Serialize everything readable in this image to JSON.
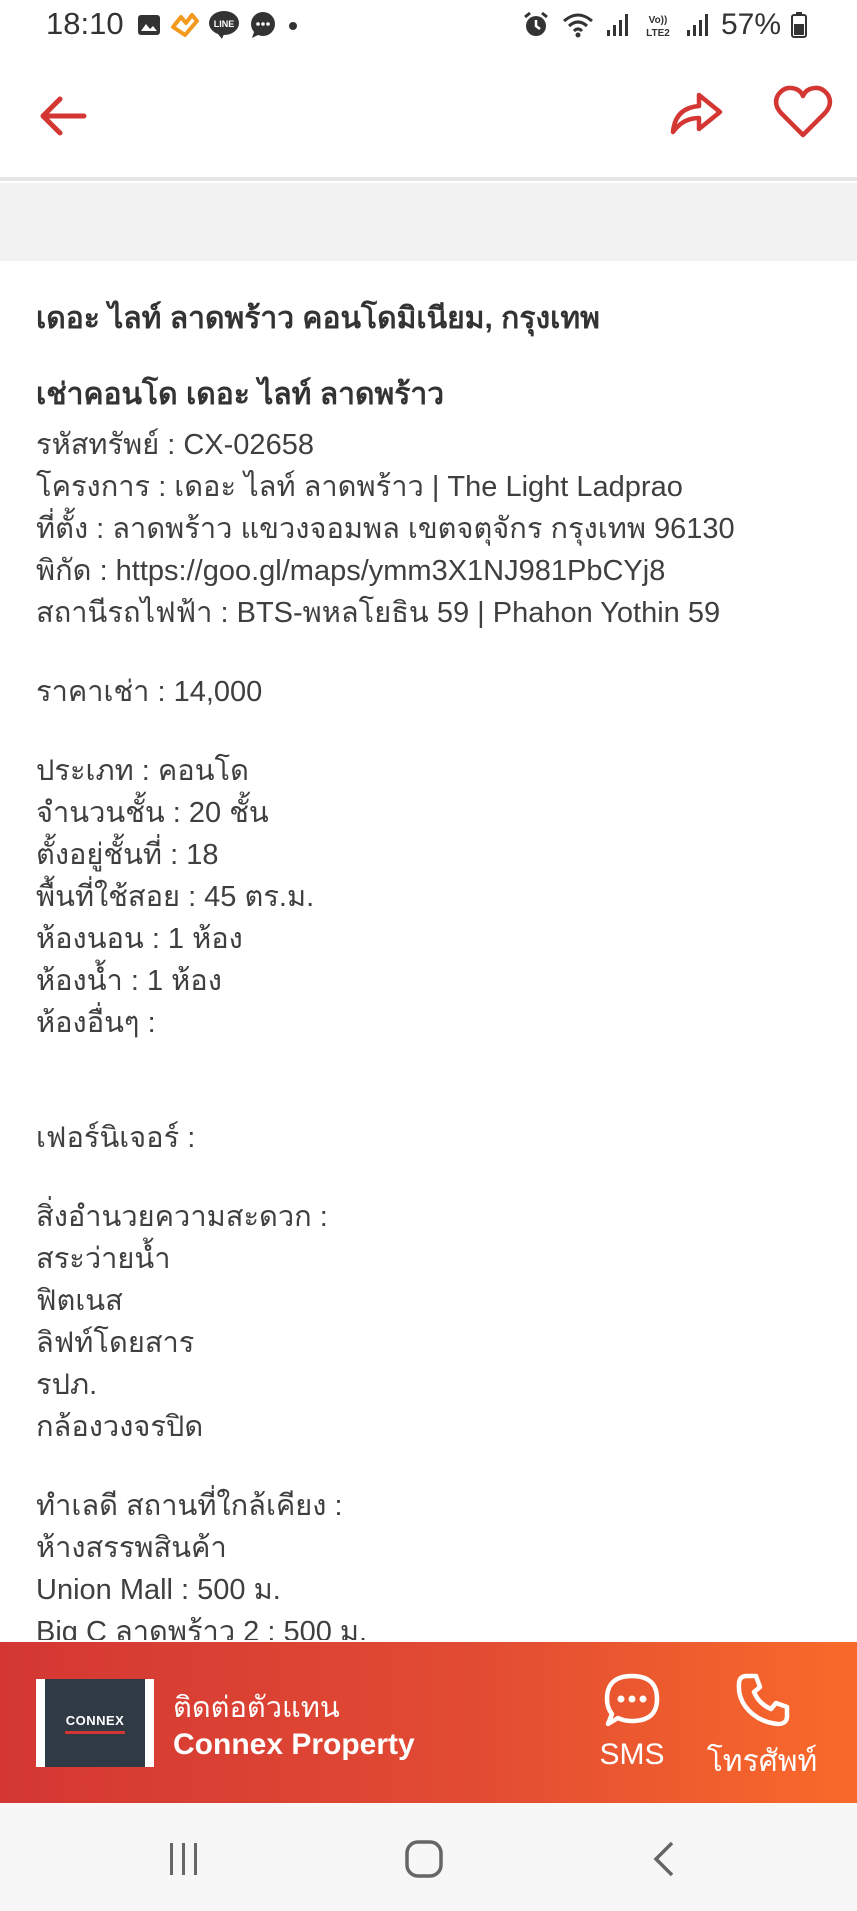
{
  "status_bar": {
    "time": "18:10",
    "battery": "57%",
    "left_icons": [
      "gallery-icon",
      "app-notification-icon",
      "line-icon",
      "chat-icon",
      "dot-icon"
    ],
    "right_icons": [
      "alarm-icon",
      "wifi-icon",
      "signal-icon",
      "volte-icon",
      "signal-icon",
      "battery-icon"
    ]
  },
  "app_bar": {
    "back_icon": "arrow-left-icon",
    "share_icon": "share-icon",
    "favorite_icon": "heart-icon",
    "accent_color": "#d43733"
  },
  "listing": {
    "title": "เดอะ ไลท์ ลาดพร้าว คอนโดมิเนียม, กรุงเทพ",
    "subtitle": "เช่าคอนโด เดอะ ไลท์ ลาดพร้าว",
    "details": [
      "รหัสทรัพย์ : CX-02658",
      "โครงการ : เดอะ ไลท์ ลาดพร้าว | The Light Ladprao",
      "ที่ตั้ง : ลาดพร้าว แขวงจอมพล เขตจตุจักร กรุงเทพ 96130",
      "พิกัด : https://goo.gl/maps/ymm3X1NJ981PbCYj8",
      "สถานีรถไฟฟ้า : BTS-พหลโยธิน 59 | Phahon Yothin 59"
    ],
    "price": "ราคาเช่า : 14,000",
    "specs": [
      "ประเภท : คอนโด",
      "จำนวนชั้น : 20 ชั้น",
      "ตั้งอยู่ชั้นที่ : 18",
      "พื้นที่ใช้สอย : 45 ตร.ม.",
      "ห้องนอน : 1 ห้อง",
      "ห้องน้ำ : 1 ห้อง",
      "ห้องอื่นๆ :"
    ],
    "furniture": "เฟอร์นิเจอร์ :",
    "facilities_heading": "สิ่งอำนวยความสะดวก :",
    "facilities": [
      "สระว่ายน้ำ",
      "ฟิตเนส",
      "ลิฟท์โดยสาร",
      "รปภ.",
      "กล้องวงจรปิด"
    ],
    "nearby_heading": "ทำเลดี สถานที่ใกล้เคียง :",
    "nearby": [
      "ห้างสรรพสินค้า",
      "Union Mall : 500 ม.",
      "Big C ลาดพร้าว 2 : 500 ม."
    ]
  },
  "contact_bar": {
    "logo_text": "CONNEX",
    "caption": "ติดต่อตัวแทน",
    "agent_name": "Connex Property",
    "sms_label": "SMS",
    "call_label": "โทรศัพท์",
    "gradient_start": "#d43733",
    "gradient_end": "#f96a2a"
  },
  "nav_bar": {
    "icons": [
      "recents-icon",
      "home-icon",
      "back-icon"
    ]
  }
}
